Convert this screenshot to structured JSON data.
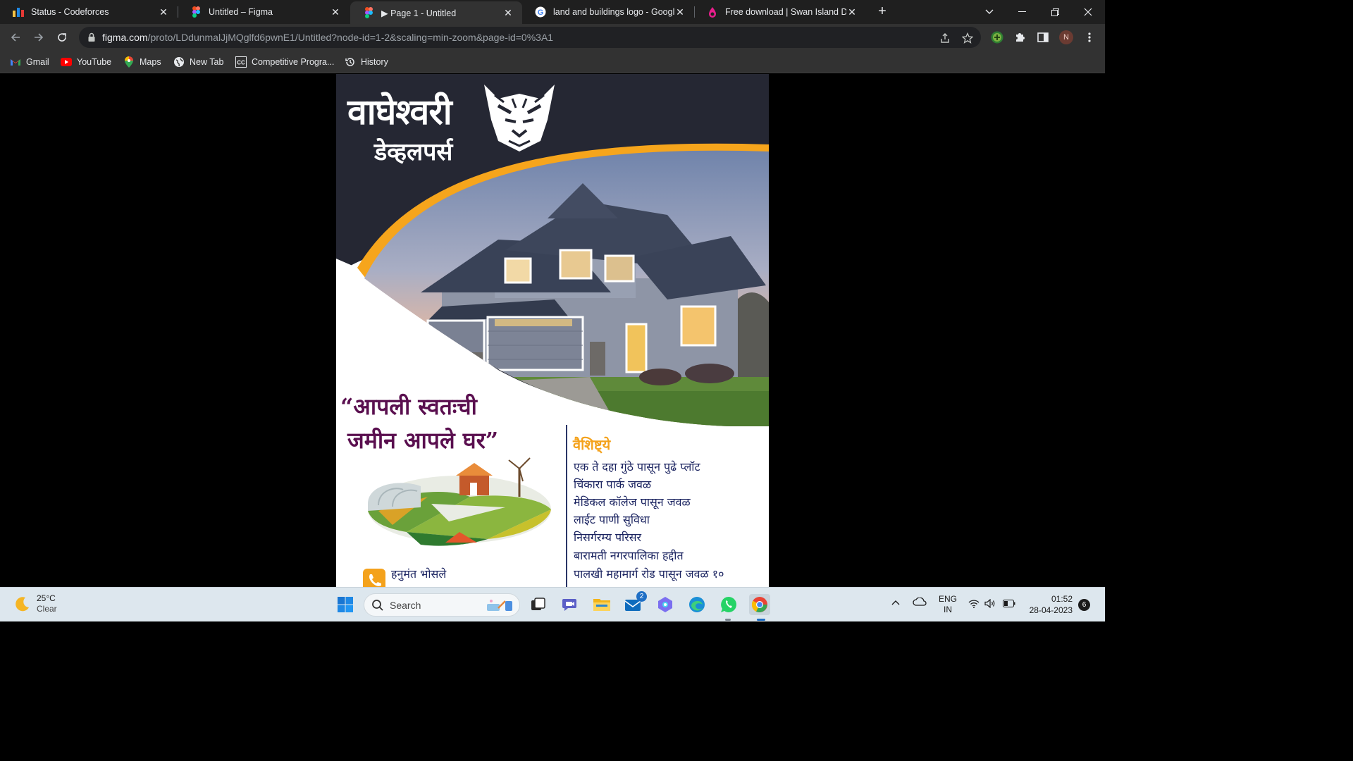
{
  "tabs": [
    {
      "title": "Status - Codeforces",
      "icon": "codeforces-icon"
    },
    {
      "title": "Untitled – Figma",
      "icon": "figma-icon"
    },
    {
      "title": "▶ Page 1 - Untitled",
      "icon": "figma-icon",
      "active": true
    },
    {
      "title": "land and buildings logo - Google",
      "icon": "google-icon"
    },
    {
      "title": "Free download | Swan Island Dah",
      "icon": "swan-icon"
    }
  ],
  "address": {
    "host": "figma.com",
    "path": "/proto/LDdunmalJjMQglfd6pwnE1/Untitled?node-id=1-2&scaling=min-zoom&page-id=0%3A1"
  },
  "profile_initial": "N",
  "bookmarks": [
    {
      "label": "Gmail",
      "icon": "gmail-icon"
    },
    {
      "label": "YouTube",
      "icon": "youtube-icon"
    },
    {
      "label": "Maps",
      "icon": "maps-icon"
    },
    {
      "label": "New Tab",
      "icon": "globe-icon"
    },
    {
      "label": "Competitive Progra...",
      "icon": "cc-icon"
    },
    {
      "label": "History",
      "icon": "history-icon"
    }
  ],
  "poster": {
    "brand_line1": "वाघेश्वरी",
    "brand_line2": "डेव्हलपर्स",
    "tagline_line1": "“आपली स्वतःची",
    "tagline_line2": "जमीन आपले घर”",
    "features_title": "वैशिष्ट्ये",
    "features": [
      "एक ते दहा गुंठे पासून पुढे प्लॉट",
      "चिंकारा पार्क जवळ",
      "मेडिकल कॉलेज पासून जवळ",
      "लाईट पाणी सुविधा",
      "निसर्गरम्य परिसर",
      "बारामती नगरपालिका हद्दीत",
      "पालखी महामार्ग रोड पासून जवळ १०"
    ],
    "contact_name": "हनुमंत भोसले",
    "colors": {
      "dark": "#252733",
      "accent": "#f6a51c",
      "tagline": "#5a0f4f",
      "text": "#1a2360"
    }
  },
  "taskbar": {
    "temperature": "25°C",
    "condition": "Clear",
    "search_label": "Search",
    "mail_badge": "2",
    "language": "ENG",
    "region": "IN",
    "time": "01:52",
    "date": "28-04-2023",
    "notifications": "6"
  }
}
